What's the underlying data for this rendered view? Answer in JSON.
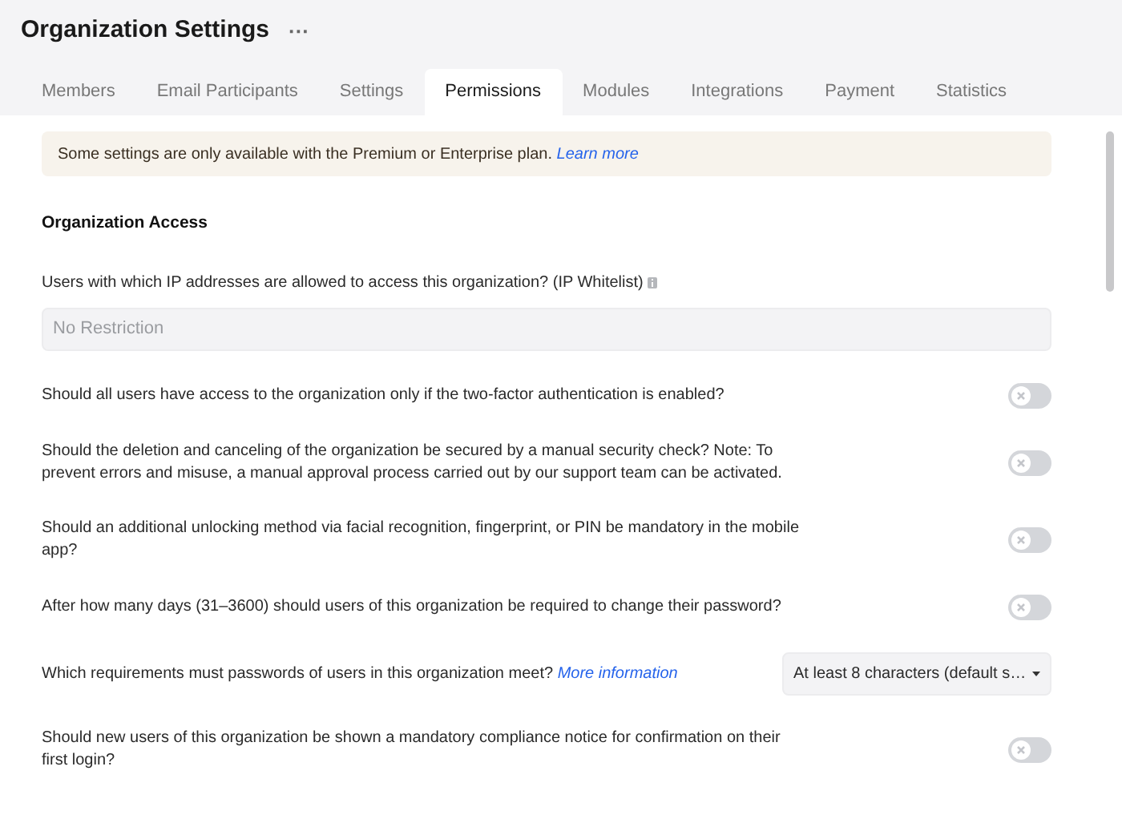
{
  "title": "Organization Settings",
  "more": "···",
  "tabs": [
    {
      "label": "Members",
      "selected": false
    },
    {
      "label": "Email Participants",
      "selected": false
    },
    {
      "label": "Settings",
      "selected": false
    },
    {
      "label": "Permissions",
      "selected": true
    },
    {
      "label": "Modules",
      "selected": false
    },
    {
      "label": "Integrations",
      "selected": false
    },
    {
      "label": "Payment",
      "selected": false
    },
    {
      "label": "Statistics",
      "selected": false
    }
  ],
  "notice": {
    "text": "Some settings are only available with the Premium or Enterprise plan.",
    "link": "Learn more"
  },
  "section": "Organization Access",
  "settings": [
    {
      "kind": "field",
      "label": "Users with which IP addresses are allowed to access this organization? (IP Whitelist)",
      "placeholder": "No Restriction"
    },
    {
      "kind": "toggle",
      "label": "Should all users have access to the organization only if the two-factor authentication is enabled?",
      "on": false
    },
    {
      "kind": "toggle",
      "label": "Should the deletion and canceling of the organization be secured by a manual security check? Note: To prevent errors and misuse, a manual approval process carried out by our support team can be activated.",
      "on": false
    },
    {
      "kind": "toggle",
      "label": "Should an additional unlocking method via facial recognition, fingerprint, or PIN be mandatory in the mobile app?",
      "on": false
    },
    {
      "kind": "toggle",
      "label": "After how many days (31–3600) should users of this organization be required to change their password?",
      "on": false
    },
    {
      "kind": "select",
      "label": "Which requirements must passwords of users in this organization meet?",
      "link": "More information",
      "value": "At least 8 characters (default s…"
    },
    {
      "kind": "toggle",
      "label": "Should new users of this organization be shown a mandatory compliance notice for confirmation on their first login?",
      "on": false
    }
  ]
}
